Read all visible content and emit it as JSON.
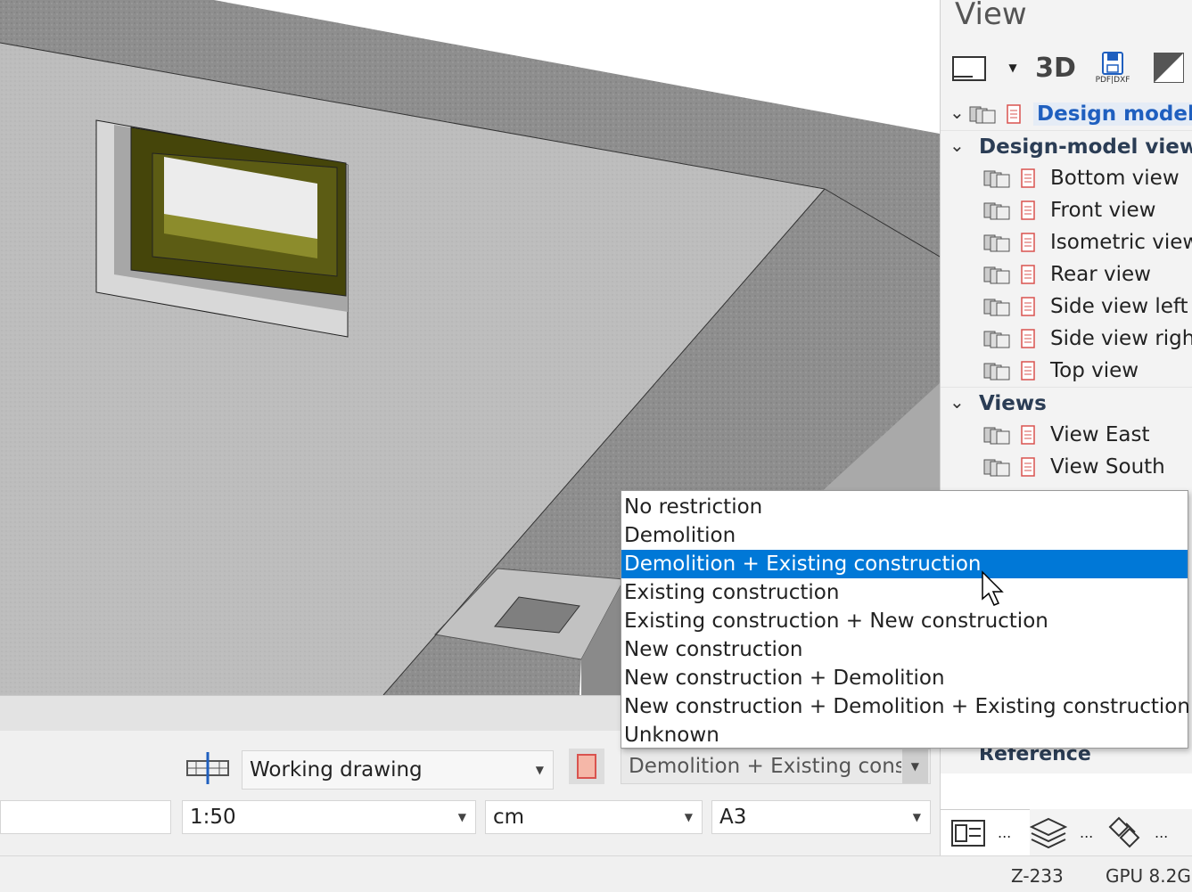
{
  "panel": {
    "title": "View",
    "toolbar": {
      "threed_label": "3D",
      "pdf_dxf_label": "PDF|DXF"
    },
    "tree": {
      "root": "Design model",
      "group1": "Design-model views",
      "group1_items": [
        "Bottom view",
        "Front view",
        "Isometric view",
        "Rear view",
        "Side view left",
        "Side view right",
        "Top view"
      ],
      "group2": "Views",
      "group2_items": [
        "View East",
        "View South"
      ]
    },
    "reference_label": "Reference",
    "bottom_icons": {
      "more1": "...",
      "more2": "...",
      "more3": "..."
    }
  },
  "bottombar": {
    "drawing_type": "Working drawing",
    "phase_filter": "Demolition + Existing construction",
    "scale": "1:50",
    "unit": "cm",
    "paper": "A3"
  },
  "dropdown": {
    "options": [
      "No restriction",
      "Demolition",
      "Demolition + Existing construction",
      "Existing construction",
      "Existing construction + New construction",
      "New construction",
      "New construction + Demolition",
      "New construction + Demolition + Existing construction",
      "Unknown"
    ],
    "selected_index": 2
  },
  "footer": {
    "layer": "Z-233",
    "gpu": "GPU 8.2G"
  },
  "colors": {
    "accent": "#0078d7",
    "header_text": "#2b3d55",
    "model_blue": "#1f5fbf",
    "doc_red": "#d9534f",
    "window_frame": "#4a4a10"
  }
}
